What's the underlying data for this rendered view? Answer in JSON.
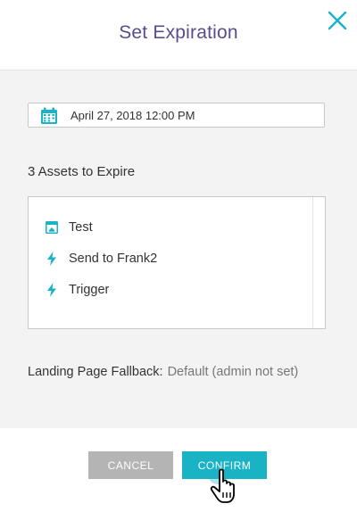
{
  "dialog": {
    "title": "Set Expiration",
    "close_icon": "close-icon",
    "date_field": {
      "value": "April 27, 2018 12:00 PM",
      "icon": "calendar-icon"
    },
    "assets": {
      "heading": "3 Assets to Expire",
      "items": [
        {
          "label": "Test",
          "icon": "landing-page-icon"
        },
        {
          "label": "Send to Frank2",
          "icon": "lightning-icon"
        },
        {
          "label": "Trigger",
          "icon": "lightning-icon"
        }
      ]
    },
    "fallback": {
      "label": "Landing Page Fallback:",
      "value": "Default (admin not set)"
    },
    "buttons": {
      "cancel": "CANCEL",
      "confirm": "CONFIRM"
    }
  },
  "colors": {
    "title": "#5a4c8e",
    "accent": "#1ab3c6",
    "cancel_bg": "#b4b4b4",
    "background": "#f3f3f3"
  }
}
